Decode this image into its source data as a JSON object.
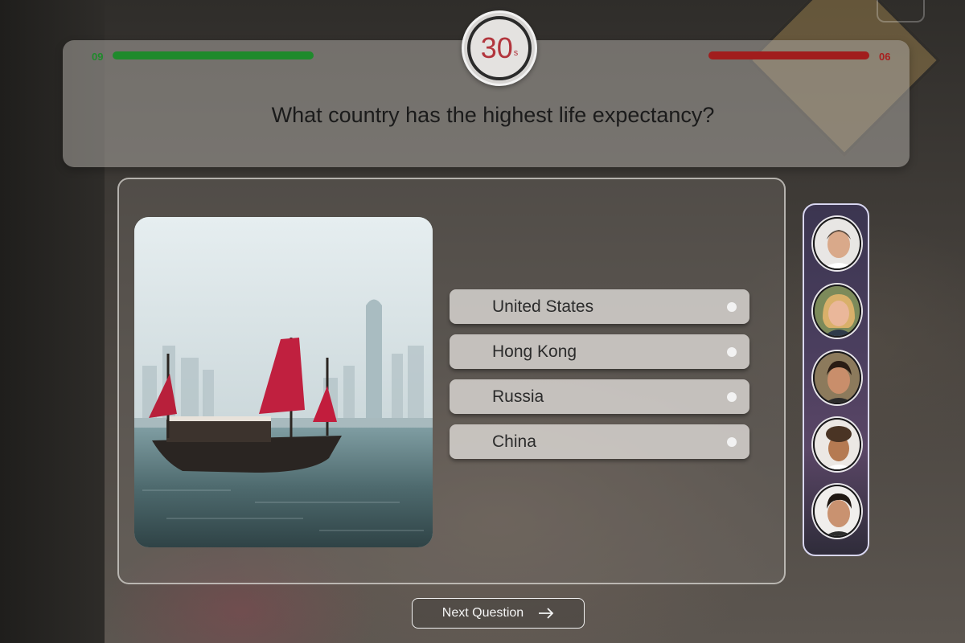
{
  "header": {
    "timer_value": "30",
    "timer_unit": "s",
    "question": "What country has the highest life expectancy?"
  },
  "scores": {
    "left": {
      "label": "09",
      "color": "#1e8a2c"
    },
    "right": {
      "label": "06",
      "color": "#a11d1d"
    }
  },
  "options": [
    {
      "label": "United States"
    },
    {
      "label": "Hong Kong"
    },
    {
      "label": "Russia"
    },
    {
      "label": "China"
    }
  ],
  "players": [
    {
      "name": "player-1",
      "icon": "avatar-man-grey-hair"
    },
    {
      "name": "player-2",
      "icon": "avatar-woman-blonde"
    },
    {
      "name": "player-3",
      "icon": "avatar-man-dark-hair"
    },
    {
      "name": "player-4",
      "icon": "avatar-man-curly-hair"
    },
    {
      "name": "player-5",
      "icon": "avatar-man-young"
    }
  ],
  "next_button": {
    "label": "Next Question",
    "icon": "arrow-right-icon"
  },
  "image": {
    "icon": "junk-boat-harbor-photo"
  }
}
